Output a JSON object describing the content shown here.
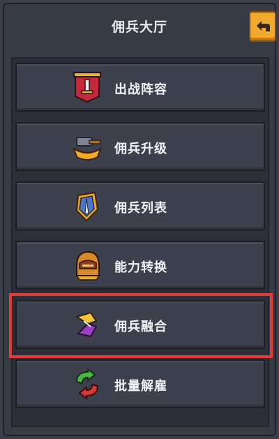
{
  "header": {
    "title": "佣兵大厅"
  },
  "menu": {
    "items": [
      {
        "label": "出战阵容",
        "icon": "banner-sword-icon"
      },
      {
        "label": "佣兵升级",
        "icon": "hammer-anvil-icon"
      },
      {
        "label": "佣兵列表",
        "icon": "shield-sword-icon"
      },
      {
        "label": "能力转换",
        "icon": "helmet-icon"
      },
      {
        "label": "佣兵融合",
        "icon": "fusion-icon",
        "highlighted": true
      },
      {
        "label": "批量解雇",
        "icon": "recycle-arrows-icon"
      }
    ]
  },
  "colors": {
    "accent": "#f0a92a",
    "highlight": "#e63a3a"
  }
}
